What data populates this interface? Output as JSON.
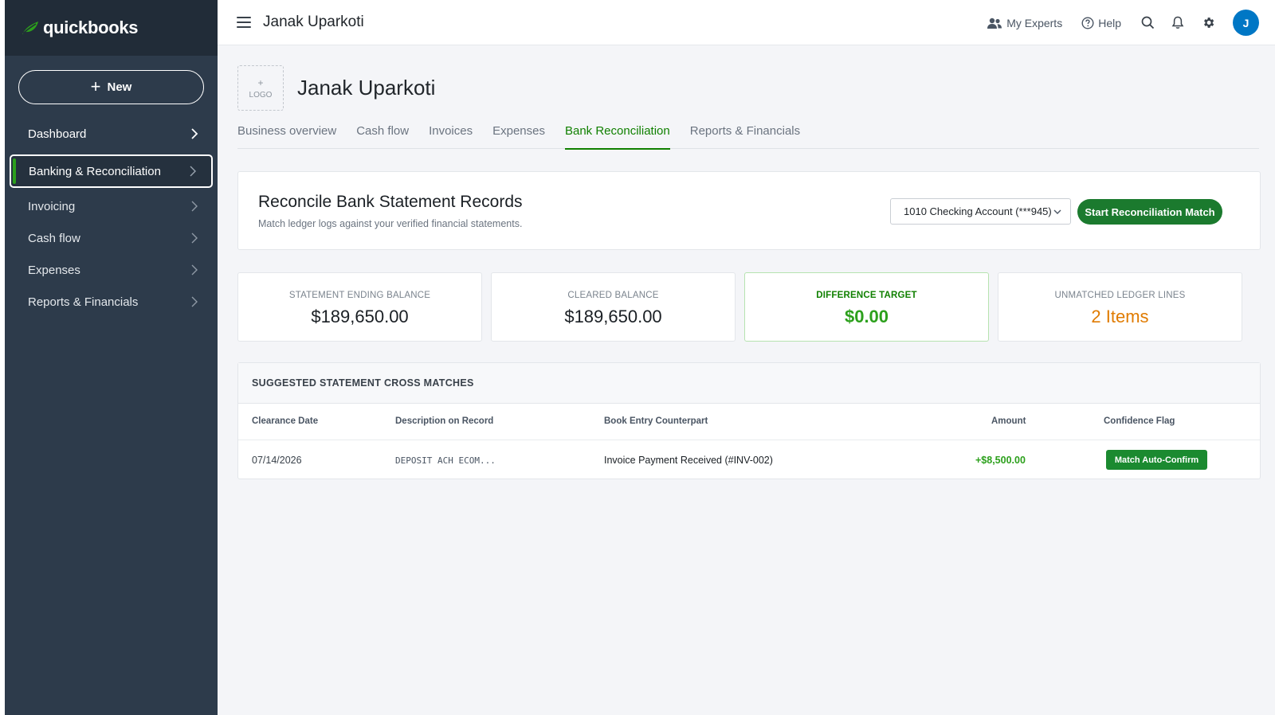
{
  "brand": {
    "name": "quickbooks",
    "accent": "#2ca01c"
  },
  "sidebar": {
    "new_label": "New",
    "items": [
      {
        "label": "Dashboard"
      },
      {
        "label": "Banking & Reconciliation"
      },
      {
        "label": "Invoicing"
      },
      {
        "label": "Cash flow"
      },
      {
        "label": "Expenses"
      },
      {
        "label": "Reports & Financials"
      }
    ]
  },
  "topbar": {
    "company": "Janak Uparkoti",
    "my_experts": "My Experts",
    "help": "Help",
    "avatar_initial": "J"
  },
  "page": {
    "logo_label": "LOGO",
    "title": "Janak Uparkoti",
    "tabs": [
      {
        "label": "Business overview"
      },
      {
        "label": "Cash flow"
      },
      {
        "label": "Invoices"
      },
      {
        "label": "Expenses"
      },
      {
        "label": "Bank Reconciliation"
      },
      {
        "label": "Reports & Financials"
      }
    ]
  },
  "reconcile": {
    "title": "Reconcile Bank Statement Records",
    "subtitle": "Match ledger logs against your verified financial statements.",
    "account": "1010 Checking Account (***945)",
    "start_label": "Start Reconciliation Match"
  },
  "stats": [
    {
      "label": "STATEMENT ENDING BALANCE",
      "value": "$189,650.00"
    },
    {
      "label": "CLEARED BALANCE",
      "value": "$189,650.00"
    },
    {
      "label": "DIFFERENCE TARGET",
      "value": "$0.00"
    },
    {
      "label": "UNMATCHED LEDGER LINES",
      "value": "2 Items"
    }
  ],
  "matches": {
    "heading": "SUGGESTED STATEMENT CROSS MATCHES",
    "columns": [
      "Clearance Date",
      "Description on Record",
      "Book Entry Counterpart",
      "Amount",
      "Confidence Flag"
    ],
    "rows": [
      {
        "date": "07/14/2026",
        "description": "DEPOSIT ACH ECOM...",
        "counterpart": "Invoice Payment Received (#INV-002)",
        "amount": "+$8,500.00",
        "flag": "Match Auto-Confirm"
      }
    ]
  }
}
